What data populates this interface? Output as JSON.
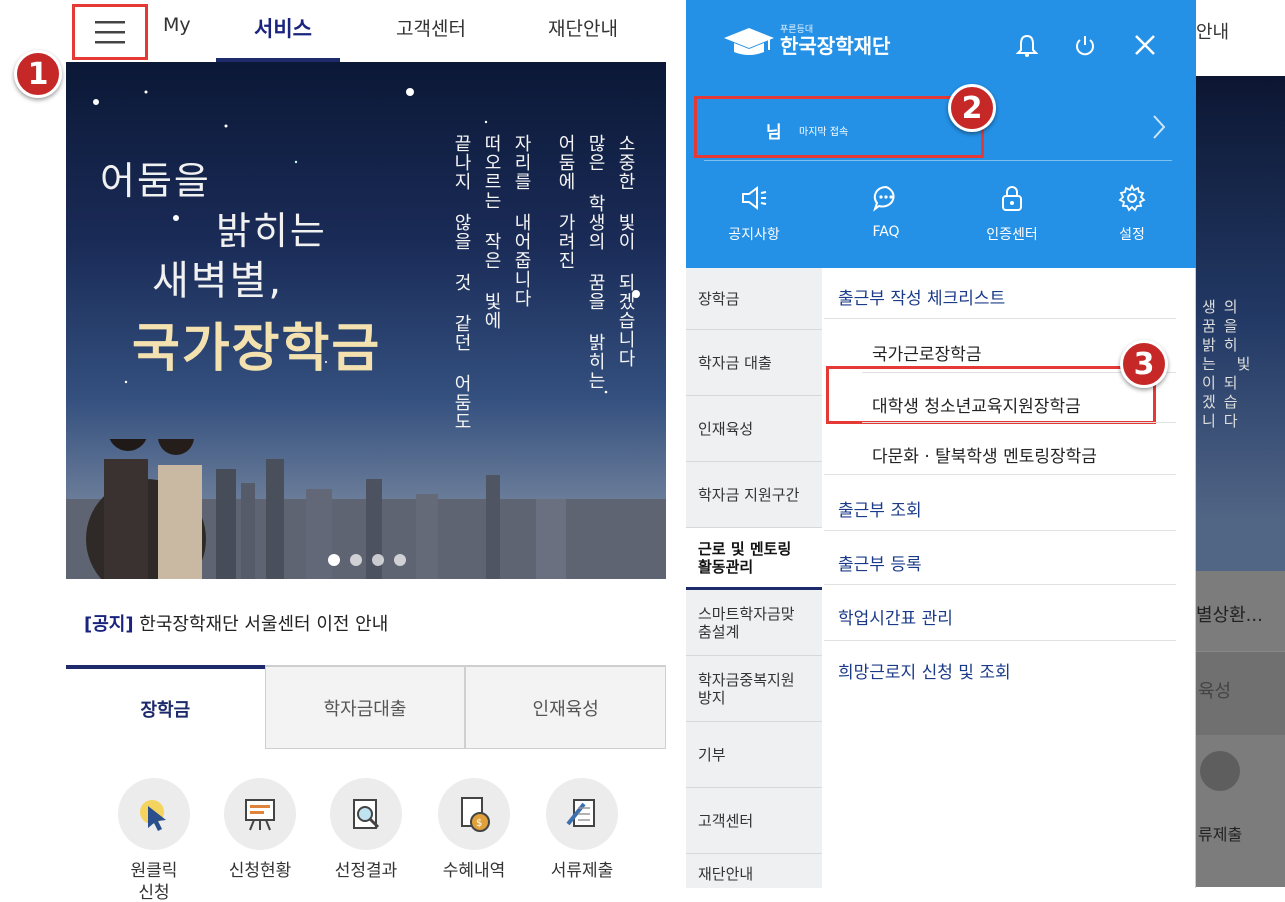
{
  "steps": [
    "1",
    "2",
    "3"
  ],
  "left": {
    "nav": {
      "my": "My",
      "service": "서비스",
      "customer": "고객센터",
      "foundation": "재단안내"
    },
    "banner": {
      "line1": "어둠을",
      "line2": "밝히는",
      "line3": "새벽별,",
      "line4": "국가장학금",
      "vtext": [
        "끝나지 않을 것 같던 어둠도",
        "떠오르는 작은 빛에",
        "자리를 내어줍니다",
        "어둠에 가려진",
        "많은 학생의 꿈을 밝히는",
        "소중한 빛이 되겠습니다"
      ]
    },
    "notice": {
      "tag": "[공지]",
      "text": " 한국장학재단 서울센터 이전 안내"
    },
    "tabs": [
      "장학금",
      "학자금대출",
      "인재육성"
    ],
    "quick": [
      {
        "label": "원클릭\n신청",
        "icon": "cursor-click-icon"
      },
      {
        "label": "신청현황",
        "icon": "presentation-board-icon"
      },
      {
        "label": "선정결과",
        "icon": "magnifier-document-icon"
      },
      {
        "label": "수혜내역",
        "icon": "money-bag-document-icon"
      },
      {
        "label": "서류제출",
        "icon": "scroll-pen-icon"
      }
    ]
  },
  "drawer": {
    "logo": {
      "small": "푸른등대",
      "main": "한국장학재단"
    },
    "user": {
      "suffix": "님",
      "last_access": "마지막 접속"
    },
    "quick": [
      {
        "label": "공지사항",
        "icon": "megaphone-icon"
      },
      {
        "label": "FAQ",
        "icon": "chat-bubble-icon"
      },
      {
        "label": "인증센터",
        "icon": "lock-icon"
      },
      {
        "label": "설정",
        "icon": "gear-icon"
      }
    ],
    "categories": [
      "장학금",
      "학자금 대출",
      "인재육성",
      "학자금 지원구간",
      "근로 및 멘토링\n활동관리",
      "스마트학자금맞\n춤설계",
      "학자금중복지원\n방지",
      "기부",
      "고객센터",
      "재단안내"
    ],
    "submenu": {
      "checklist": "출근부 작성 체크리스트",
      "national": "국가근로장학금",
      "youth": "대학생 청소년교육지원장학금",
      "multicultural": "다문화 · 탈북학생 멘토링장학금",
      "view": "출근부 조회",
      "register": "출근부 등록",
      "timetable": "학업시간표 관리",
      "hope": "희망근로지 신청 및 조회"
    }
  },
  "background": {
    "tab_text": "안내",
    "vtext": "생의꿈을밝히는 빛이되겠습니다",
    "notice_tail": "별상환...",
    "tab_tail": "육성",
    "quick_tail": "류제출"
  },
  "colors": {
    "drawer_blue": "#2491e6",
    "navy": "#1d2a6b",
    "highlight_red": "#e53935",
    "badge_red": "#c62828"
  }
}
